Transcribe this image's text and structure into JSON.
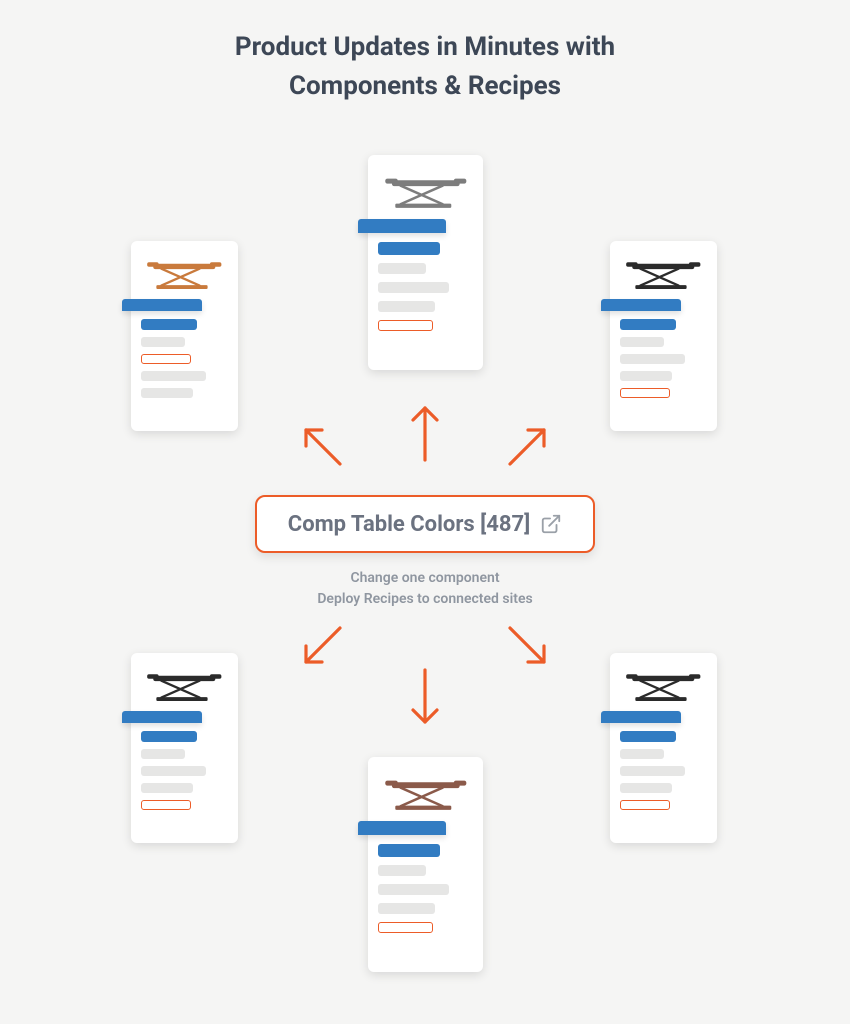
{
  "title": {
    "line1": "Product Updates in Minutes with",
    "line2": "Components & Recipes"
  },
  "pill": {
    "label": "Comp Table Colors [487]"
  },
  "subtext": {
    "line1": "Change one component",
    "line2": "Deploy Recipes to connected sites"
  },
  "cards": {
    "top_center": {
      "color": "gray",
      "highlight_pos": "bottom"
    },
    "top_left": {
      "color": "orange",
      "highlight_pos": "top"
    },
    "top_right": {
      "color": "black",
      "highlight_pos": "bottom"
    },
    "bottom_left": {
      "color": "black",
      "highlight_pos": "bottom"
    },
    "bottom_center": {
      "color": "brown",
      "highlight_pos": "bottom"
    },
    "bottom_right": {
      "color": "black",
      "highlight_pos": "bottom"
    }
  }
}
